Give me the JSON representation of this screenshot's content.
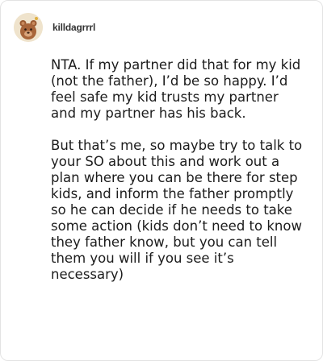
{
  "post": {
    "username": "killdagrrrl",
    "avatar_icon": "cartoon-animal-avatar-icon",
    "paragraphs": [
      "NTA. If my partner did that for my kid (not the father), I’d be so happy. I’d feel safe my kid trusts my partner and my partner has his back.",
      "But that’s me, so maybe try to talk to your SO about this and work out a plan where you can be there for step kids, and inform the father promptly so he can decide if he needs to take some action (kids don’t need to know they father know, but you can tell them you will if you see it’s necessary)"
    ]
  }
}
